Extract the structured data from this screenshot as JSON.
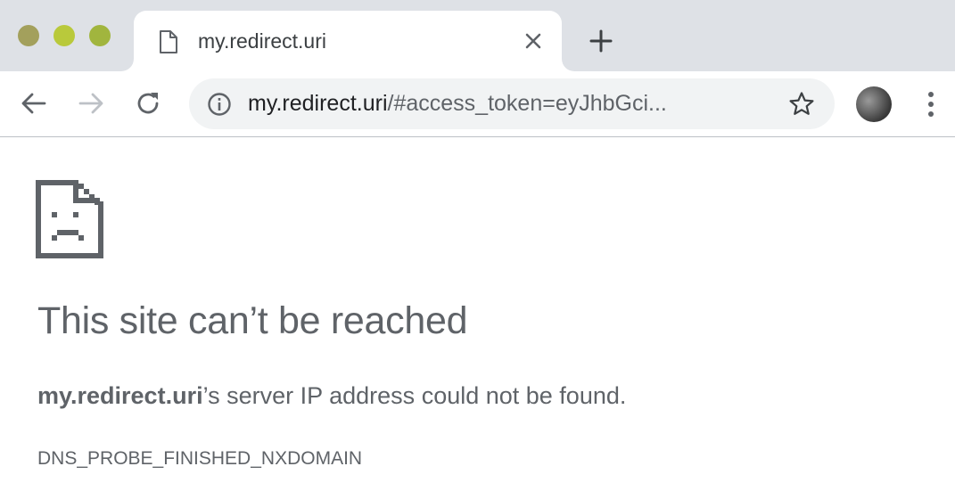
{
  "window_controls": {
    "colors": [
      "#a3a05c",
      "#b9c93b",
      "#a1b53e"
    ]
  },
  "tab": {
    "title": "my.redirect.uri",
    "favicon": "page-icon",
    "close_icon": "close-icon"
  },
  "new_tab": {
    "icon": "plus-icon"
  },
  "toolbar": {
    "back_icon": "arrow-left-icon",
    "forward_icon": "arrow-right-icon",
    "reload_icon": "reload-icon",
    "omnibox": {
      "security_icon": "info-icon",
      "url_host": "my.redirect.uri",
      "url_rest": "/#access_token=eyJhbGci...",
      "bookmark_icon": "star-icon"
    },
    "profile_icon": "avatar",
    "menu_icon": "more-vert-icon"
  },
  "content": {
    "error_icon": "sad-page-icon",
    "heading": "This site can’t be reached",
    "message_host": "my.redirect.uri",
    "message_rest": "’s server IP address could not be found.",
    "error_code": "DNS_PROBE_FINISHED_NXDOMAIN"
  },
  "colors": {
    "tab_strip_bg": "#dee1e6",
    "omnibox_bg": "#f1f3f4",
    "text_primary": "#202124",
    "text_secondary": "#5f6368",
    "forward_disabled": "#bdc1c6"
  }
}
